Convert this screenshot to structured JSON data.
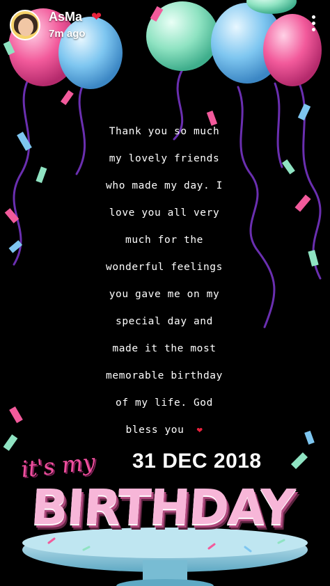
{
  "story": {
    "username": "AsMa",
    "timestamp": "7m ago",
    "icons": {
      "avatar": "bitmoji-avatar",
      "badge": "red-heart-icon",
      "menu": "vertical-dots-icon",
      "message_emoji": "red-heart-icon"
    }
  },
  "message_lines": [
    "Thank you so much",
    "my lovely friends",
    "who made my day. I",
    "love you all very",
    "much for the",
    "wonderful feelings",
    "you gave me on my",
    "special day and",
    "made it the most",
    "memorable birthday",
    "of my life. God",
    "bless you"
  ],
  "sticker": {
    "its_my": "it's my",
    "birthday": "BIRTHDAY",
    "date": "31 DEC 2018"
  },
  "colors": {
    "background": "#000000",
    "balloon_pink": "#f25a9b",
    "balloon_blue": "#7ec6f0",
    "balloon_green": "#8fe3c2",
    "ribbon_purple": "#6a2fb0",
    "heart_red": "#e8213c",
    "birthday_pink": "#f7b6d8",
    "cake_stand": "#9fd6e6"
  }
}
